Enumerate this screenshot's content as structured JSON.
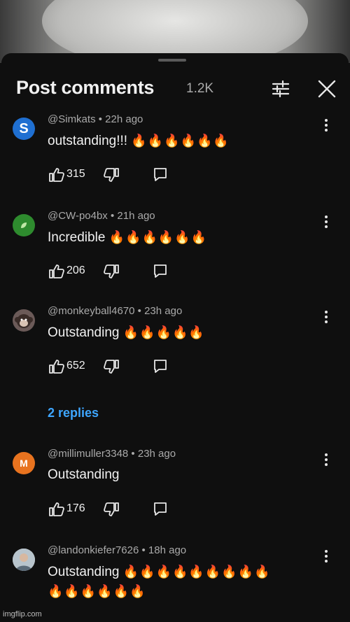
{
  "header": {
    "title": "Post comments",
    "count": "1.2K"
  },
  "comments": [
    {
      "avatar_letter": "S",
      "avatar_color": "#1f6fd1",
      "handle": "@Simkats",
      "time": "22h ago",
      "text": "outstanding!!!",
      "emoji": "🔥🔥🔥🔥🔥🔥",
      "emoji2": "",
      "likes": "315"
    },
    {
      "avatar_letter": "",
      "avatar_color": "#2e8b2e",
      "handle": "@CW-po4bx",
      "time": "21h ago",
      "text": "Incredible",
      "emoji": "🔥🔥🔥🔥🔥🔥",
      "emoji2": "",
      "likes": "206"
    },
    {
      "avatar_letter": "",
      "avatar_color": "#6b5a58",
      "handle": "@monkeyball4670",
      "time": "23h ago",
      "text": "Outstanding",
      "emoji": "🔥🔥🔥🔥🔥",
      "emoji2": "",
      "likes": "652"
    },
    {
      "avatar_letter": "M",
      "avatar_color": "#e8731f",
      "handle": "@millimuller3348",
      "time": "23h ago",
      "text": "Outstanding",
      "emoji": "",
      "emoji2": "",
      "likes": "176"
    },
    {
      "avatar_letter": "",
      "avatar_color": "#c9c9c9",
      "handle": "@landonkiefer7626",
      "time": "18h ago",
      "text": "Outstanding",
      "emoji": "🔥🔥🔥🔥🔥🔥🔥🔥🔥",
      "emoji2": "🔥🔥🔥🔥🔥🔥",
      "likes": ""
    }
  ],
  "replies_link": "2 replies",
  "watermark": "imgflip.com"
}
